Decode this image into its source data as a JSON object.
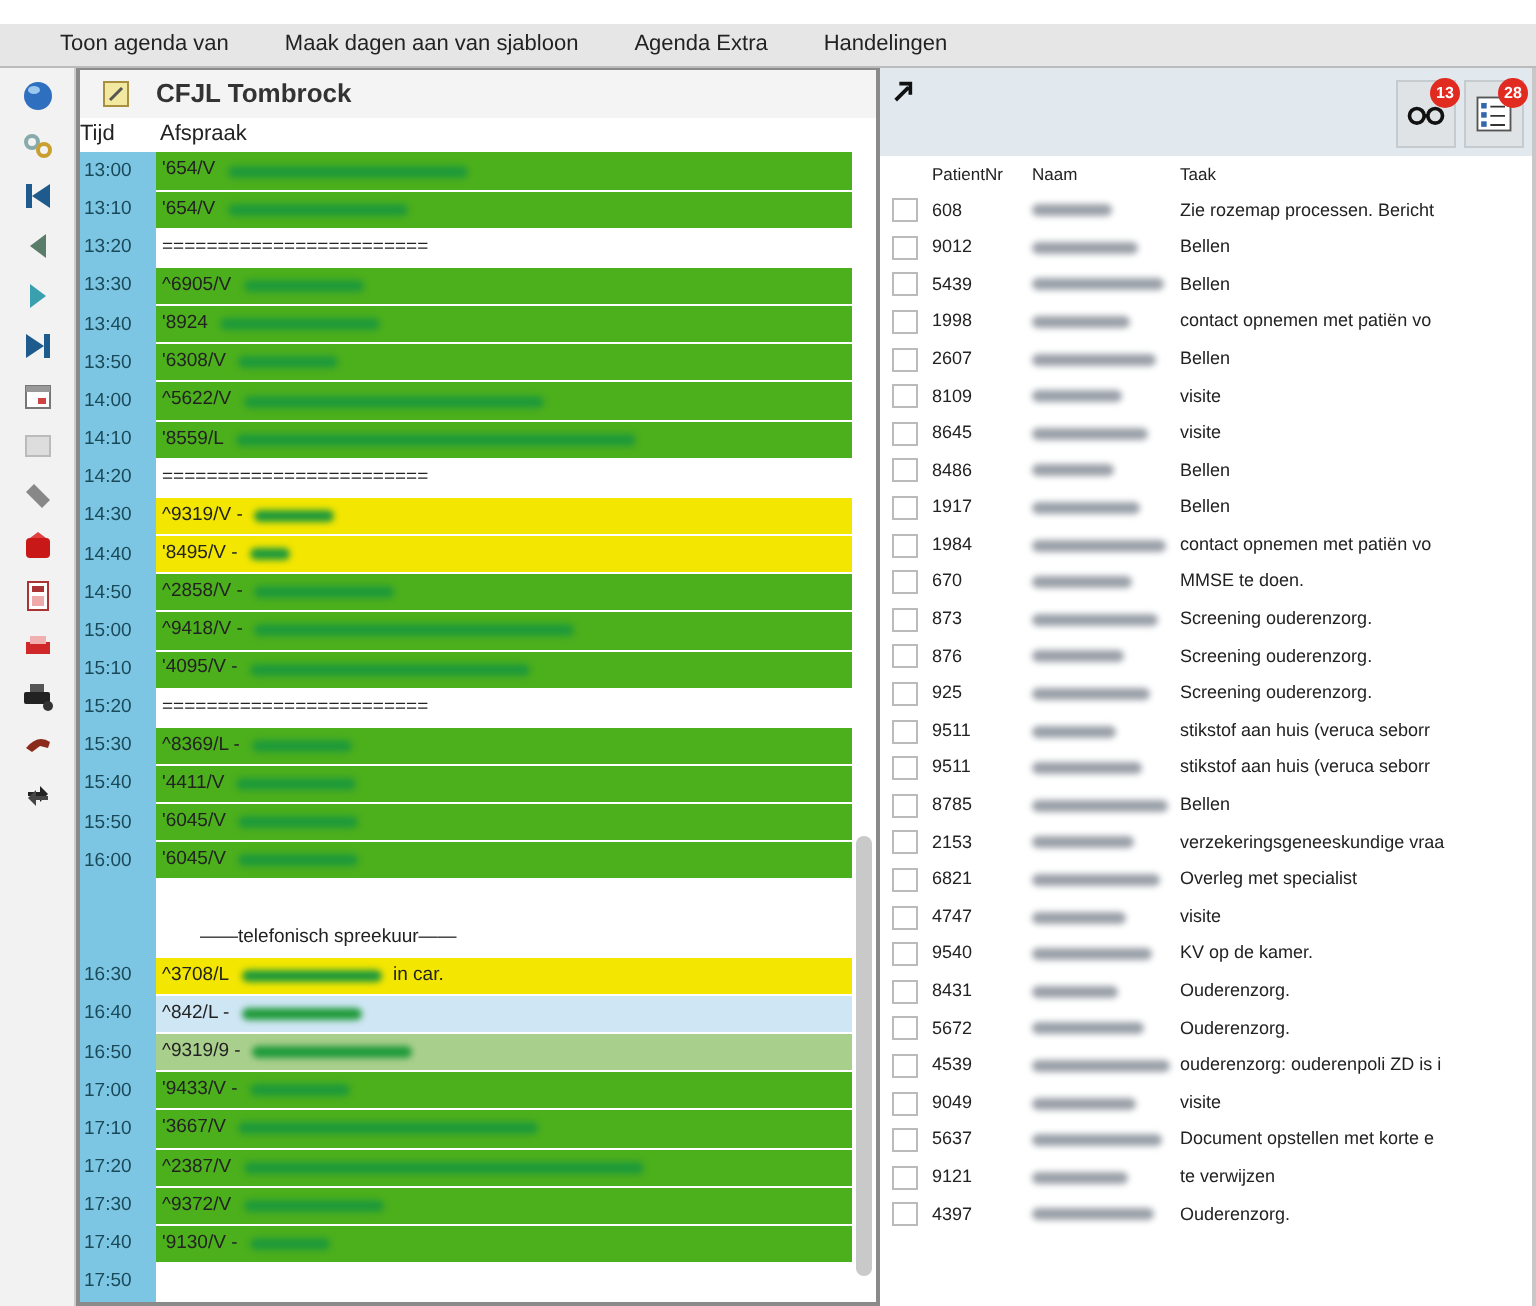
{
  "menu": [
    {
      "label": "Toon agenda van"
    },
    {
      "label": "Maak dagen aan van sjabloon"
    },
    {
      "label": "Agenda Extra"
    },
    {
      "label": "Handelingen"
    }
  ],
  "agenda": {
    "title": "CFJL Tombrock",
    "columns": [
      "Tijd",
      "Afspraak"
    ],
    "rows": [
      {
        "time": "13:00",
        "kind": "appointment",
        "code": "'654/V",
        "color": "#4caf1c",
        "name_hidden": true
      },
      {
        "time": "13:10",
        "kind": "appointment",
        "code": "'654/V",
        "color": "#4caf1c",
        "name_hidden": true
      },
      {
        "time": "13:20",
        "kind": "separator",
        "code": "========================"
      },
      {
        "time": "13:30",
        "kind": "appointment",
        "code": "^6905/V",
        "color": "#4caf1c",
        "name_hidden": true
      },
      {
        "time": "13:40",
        "kind": "appointment",
        "code": "'8924",
        "color": "#4caf1c",
        "name_hidden": true
      },
      {
        "time": "13:50",
        "kind": "appointment",
        "code": "'6308/V",
        "color": "#4caf1c",
        "name_hidden": true
      },
      {
        "time": "14:00",
        "kind": "appointment",
        "code": "^5622/V",
        "color": "#4caf1c",
        "name_hidden": true
      },
      {
        "time": "14:10",
        "kind": "appointment",
        "code": "'8559/L",
        "color": "#4caf1c",
        "name_hidden": true
      },
      {
        "time": "14:20",
        "kind": "separator",
        "code": "========================"
      },
      {
        "time": "14:30",
        "kind": "appointment",
        "code": "^9319/V -",
        "color": "#f3e600",
        "name_hidden": true
      },
      {
        "time": "14:40",
        "kind": "appointment",
        "code": "'8495/V -",
        "color": "#f3e600",
        "name_hidden": true
      },
      {
        "time": "14:50",
        "kind": "appointment",
        "code": "^2858/V -",
        "color": "#4caf1c",
        "name_hidden": true
      },
      {
        "time": "15:00",
        "kind": "appointment",
        "code": "^9418/V -",
        "color": "#4caf1c",
        "name_hidden": true
      },
      {
        "time": "15:10",
        "kind": "appointment",
        "code": "'4095/V -",
        "color": "#4caf1c",
        "name_hidden": true
      },
      {
        "time": "15:20",
        "kind": "separator",
        "code": "========================"
      },
      {
        "time": "15:30",
        "kind": "appointment",
        "code": "^8369/L -",
        "color": "#4caf1c",
        "name_hidden": true
      },
      {
        "time": "15:40",
        "kind": "appointment",
        "code": "'4411/V",
        "color": "#4caf1c",
        "name_hidden": true
      },
      {
        "time": "15:50",
        "kind": "appointment",
        "code": "'6045/V",
        "color": "#4caf1c",
        "name_hidden": true
      },
      {
        "time": "16:00",
        "kind": "appointment",
        "code": "'6045/V",
        "color": "#4caf1c",
        "name_hidden": true
      },
      {
        "kind": "blank"
      },
      {
        "kind": "note",
        "code": "——telefonisch spreekuur——"
      },
      {
        "time": "16:30",
        "kind": "appointment",
        "code": "^3708/L",
        "color": "#f3e600",
        "name_hidden": true,
        "note": "in car."
      },
      {
        "time": "16:40",
        "kind": "appointment",
        "code": "^842/L -",
        "color": "#cfe6f4",
        "name_hidden": true
      },
      {
        "time": "16:50",
        "kind": "appointment",
        "code": "^9319/9 -",
        "color": "#a9cf8c",
        "name_hidden": true
      },
      {
        "time": "17:00",
        "kind": "appointment",
        "code": "'9433/V -",
        "color": "#4caf1c",
        "name_hidden": true
      },
      {
        "time": "17:10",
        "kind": "appointment",
        "code": "'3667/V",
        "color": "#4caf1c",
        "name_hidden": true
      },
      {
        "time": "17:20",
        "kind": "appointment",
        "code": "^2387/V",
        "color": "#4caf1c",
        "name_hidden": true
      },
      {
        "time": "17:30",
        "kind": "appointment",
        "code": "^9372/V",
        "color": "#4caf1c",
        "name_hidden": true
      },
      {
        "time": "17:40",
        "kind": "appointment",
        "code": "'9130/V -",
        "color": "#4caf1c",
        "name_hidden": true
      },
      {
        "time": "17:50",
        "kind": "empty"
      }
    ]
  },
  "tasks": {
    "badges": [
      "13",
      "28"
    ],
    "columns": [
      "PatientNr",
      "Naam",
      "Taak"
    ],
    "rows": [
      {
        "nr": "608",
        "checked": false,
        "name_hidden": true,
        "task": "Zie rozemap processen. Bericht"
      },
      {
        "nr": "9012",
        "checked": false,
        "name_hidden": true,
        "task": "Bellen"
      },
      {
        "nr": "5439",
        "checked": false,
        "name_hidden": true,
        "task": "Bellen"
      },
      {
        "nr": "1998",
        "checked": false,
        "name_hidden": true,
        "task": "contact opnemen met patiën vo"
      },
      {
        "nr": "2607",
        "checked": false,
        "name_hidden": true,
        "task": "Bellen"
      },
      {
        "nr": "8109",
        "checked": false,
        "name_hidden": true,
        "task": "visite"
      },
      {
        "nr": "8645",
        "checked": false,
        "name_hidden": true,
        "task": "visite"
      },
      {
        "nr": "8486",
        "checked": false,
        "name_hidden": true,
        "task": "Bellen"
      },
      {
        "nr": "1917",
        "checked": false,
        "name_hidden": true,
        "task": "Bellen"
      },
      {
        "nr": "1984",
        "checked": false,
        "name_hidden": true,
        "task": "contact opnemen met patiën vo"
      },
      {
        "nr": "670",
        "checked": false,
        "name_hidden": true,
        "task": "MMSE te doen."
      },
      {
        "nr": "873",
        "checked": false,
        "name_hidden": true,
        "task": "Screening ouderenzorg."
      },
      {
        "nr": "876",
        "checked": false,
        "name_hidden": true,
        "task": "Screening ouderenzorg."
      },
      {
        "nr": "925",
        "checked": false,
        "name_hidden": true,
        "task": "Screening ouderenzorg."
      },
      {
        "nr": "9511",
        "checked": false,
        "name_hidden": true,
        "task": "stikstof aan huis (veruca seborr"
      },
      {
        "nr": "9511",
        "checked": false,
        "name_hidden": true,
        "task": "stikstof aan huis (veruca seborr"
      },
      {
        "nr": "8785",
        "checked": false,
        "name_hidden": true,
        "task": "Bellen"
      },
      {
        "nr": "2153",
        "checked": false,
        "name_hidden": true,
        "task": "verzekeringsgeneeskundige vraa"
      },
      {
        "nr": "6821",
        "checked": false,
        "name_hidden": true,
        "task": "Overleg met specialist"
      },
      {
        "nr": "4747",
        "checked": false,
        "name_hidden": true,
        "task": "visite"
      },
      {
        "nr": "9540",
        "checked": false,
        "name_hidden": true,
        "task": "KV op de kamer."
      },
      {
        "nr": "8431",
        "checked": false,
        "name_hidden": true,
        "task": "Ouderenzorg."
      },
      {
        "nr": "5672",
        "checked": false,
        "name_hidden": true,
        "task": "Ouderenzorg."
      },
      {
        "nr": "4539",
        "checked": false,
        "name_hidden": true,
        "task": "ouderenzorg: ouderenpoli ZD is i"
      },
      {
        "nr": "9049",
        "checked": false,
        "name_hidden": true,
        "task": "visite"
      },
      {
        "nr": "5637",
        "checked": false,
        "name_hidden": true,
        "task": "Document opstellen met korte e"
      },
      {
        "nr": "9121",
        "checked": false,
        "name_hidden": true,
        "task": "te verwijzen"
      },
      {
        "nr": "4397",
        "checked": false,
        "name_hidden": true,
        "task": "Ouderenzorg."
      }
    ]
  }
}
